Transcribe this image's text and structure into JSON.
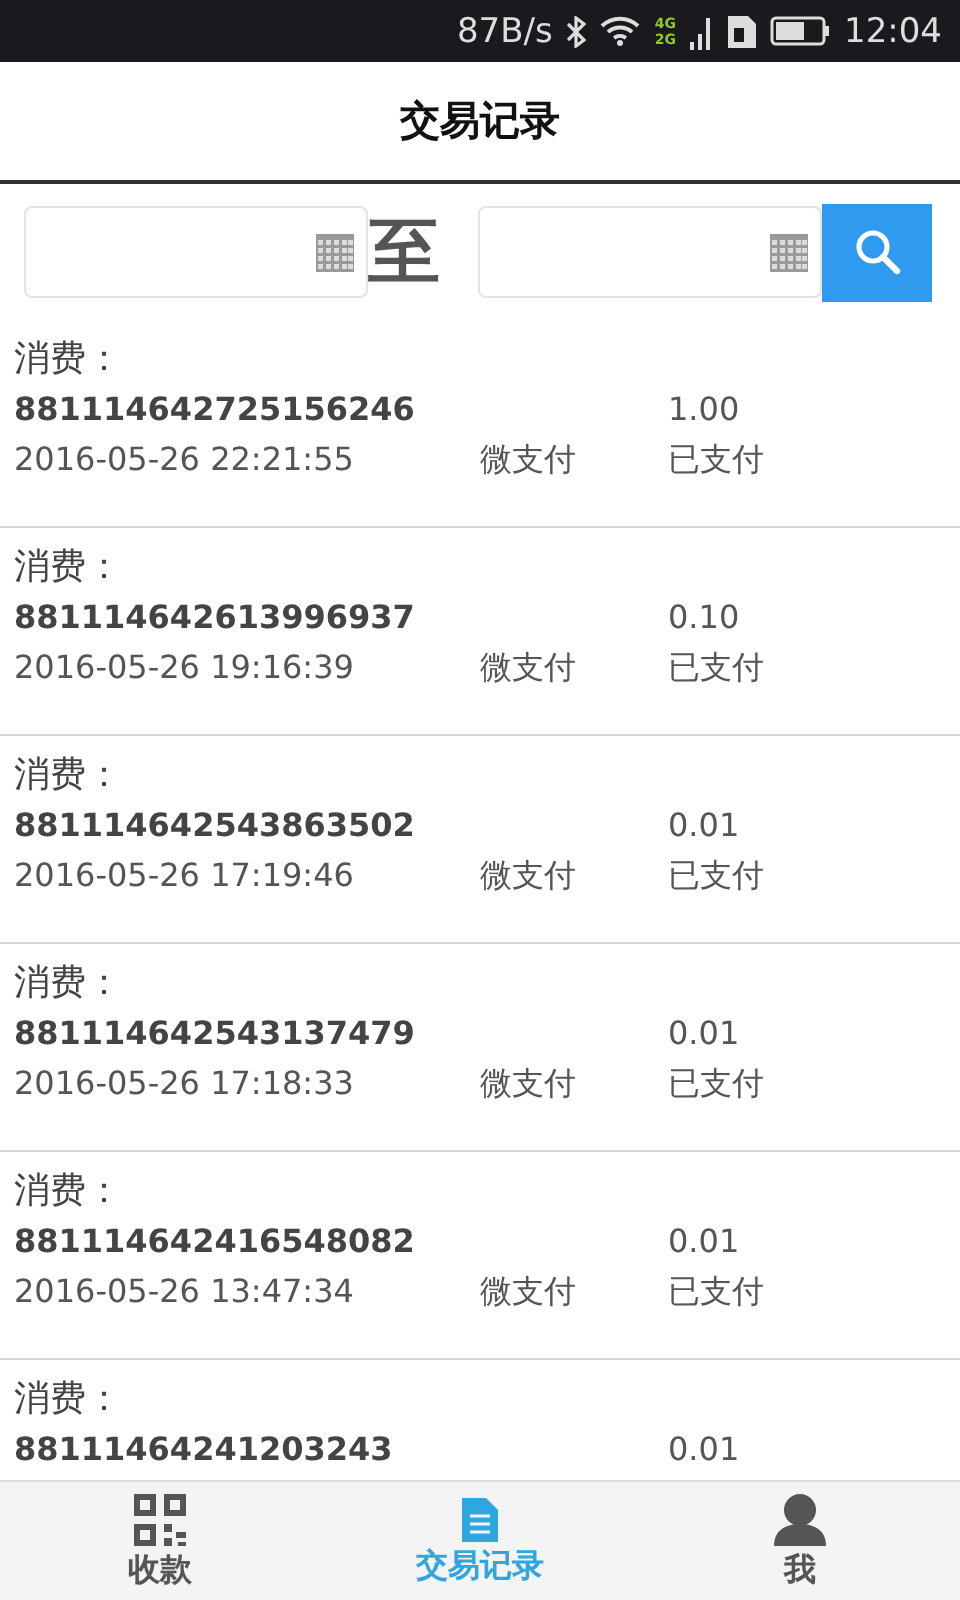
{
  "status_bar": {
    "speed": "87B/s",
    "network_top": "4G",
    "network_bottom": "2G",
    "time": "12:04"
  },
  "header": {
    "title": "交易记录"
  },
  "search": {
    "separator": "至"
  },
  "records": [
    {
      "label": "消费：",
      "order_no": "881114642725156246",
      "amount": "1.00",
      "datetime": "2016-05-26 22:21:55",
      "method": "微支付",
      "status": "已支付"
    },
    {
      "label": "消费：",
      "order_no": "881114642613996937",
      "amount": "0.10",
      "datetime": "2016-05-26 19:16:39",
      "method": "微支付",
      "status": "已支付"
    },
    {
      "label": "消费：",
      "order_no": "881114642543863502",
      "amount": "0.01",
      "datetime": "2016-05-26 17:19:46",
      "method": "微支付",
      "status": "已支付"
    },
    {
      "label": "消费：",
      "order_no": "881114642543137479",
      "amount": "0.01",
      "datetime": "2016-05-26 17:18:33",
      "method": "微支付",
      "status": "已支付"
    },
    {
      "label": "消费：",
      "order_no": "881114642416548082",
      "amount": "0.01",
      "datetime": "2016-05-26 13:47:34",
      "method": "微支付",
      "status": "已支付"
    },
    {
      "label": "消费：",
      "order_no": "88111464241203243",
      "amount": "0.01"
    }
  ],
  "tabs": [
    {
      "kind": "qr",
      "label": "收款",
      "selected": false
    },
    {
      "kind": "document",
      "label": "交易记录",
      "selected": true
    },
    {
      "kind": "person",
      "label": "我",
      "selected": false
    }
  ]
}
